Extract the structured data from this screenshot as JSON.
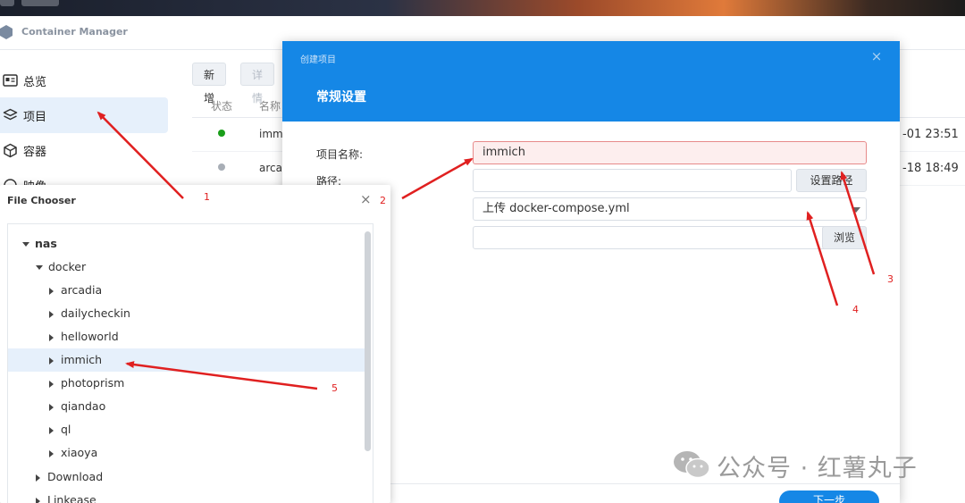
{
  "app": {
    "title": "Container Manager"
  },
  "sidebar": {
    "items": [
      {
        "label": "总览",
        "icon": "overview-icon"
      },
      {
        "label": "项目",
        "icon": "layers-icon",
        "active": true
      },
      {
        "label": "容器",
        "icon": "cube-icon"
      },
      {
        "label": "映像",
        "icon": "image-icon"
      }
    ]
  },
  "toolbar": {
    "new_label": "新增",
    "detail_label": "详情"
  },
  "table": {
    "columns": [
      "状态",
      "名称"
    ],
    "rows": [
      {
        "name": "imm",
        "time": "-01 23:51",
        "status_color": "#1a9e1a"
      },
      {
        "name": "arca",
        "time": "-18 18:49",
        "status_color": "#a8aeb6"
      }
    ]
  },
  "dialog": {
    "small_title": "创建项目",
    "close_symbol": "×",
    "section_title": "常规设置",
    "project_name_label": "项目名称:",
    "project_name_value": "immich",
    "path_label": "路径:",
    "set_path_button": "设置路径",
    "source_value": "上传 docker-compose.yml",
    "browse_button": "浏览",
    "next_button": "下一步"
  },
  "file_chooser": {
    "title": "File Chooser",
    "close_symbol": "×",
    "tree": [
      {
        "label": "nas",
        "level": 0,
        "expanded": true
      },
      {
        "label": "docker",
        "level": 1,
        "expanded": true
      },
      {
        "label": "arcadia",
        "level": 2
      },
      {
        "label": "dailycheckin",
        "level": 2
      },
      {
        "label": "helloworld",
        "level": 2
      },
      {
        "label": "immich",
        "level": 2,
        "selected": true
      },
      {
        "label": "photoprism",
        "level": 2
      },
      {
        "label": "qiandao",
        "level": 2
      },
      {
        "label": "ql",
        "level": 2
      },
      {
        "label": "xiaoya",
        "level": 2
      },
      {
        "label": "Download",
        "level": 1
      },
      {
        "label": "Linkease",
        "level": 1
      }
    ]
  },
  "annotations": {
    "color": "#e02020",
    "labels": [
      "1",
      "2",
      "3",
      "4",
      "5"
    ]
  },
  "watermark": {
    "text": "公众号 · 红薯丸子"
  }
}
